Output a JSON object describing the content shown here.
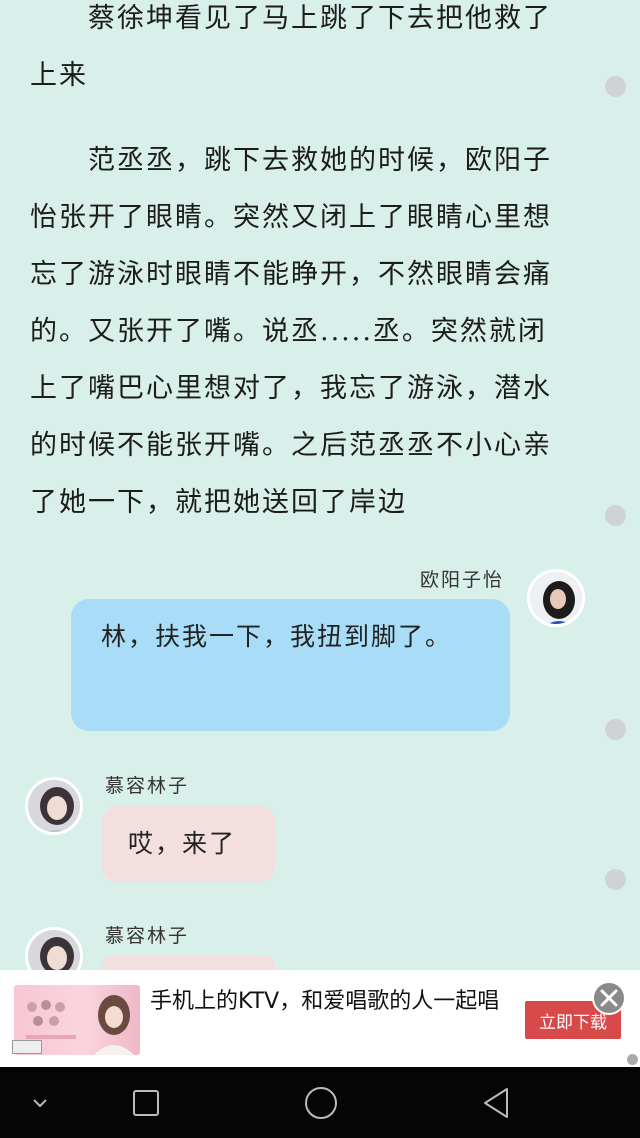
{
  "story": {
    "paragraph1": "蔡徐坤看见了马上跳了下去把他救了上来",
    "paragraph2": "范丞丞，跳下去救她的时候，欧阳子怡张开了眼睛。突然又闭上了眼睛心里想忘了游泳时眼睛不能睁开，不然眼睛会痛的。又张开了嘴。说丞.....丞。突然就闭上了嘴巴心里想对了，我忘了游泳，潜水的时候不能张开嘴。之后范丞丞不小心亲了她一下，就把她送回了岸边"
  },
  "chat": {
    "msg1": {
      "sender": "欧阳子怡",
      "text": "林，扶我一下，我扭到脚了。"
    },
    "msg2": {
      "sender": "慕容林子",
      "text": "哎，来了"
    },
    "msg3": {
      "sender": "慕容林子",
      "text": ""
    }
  },
  "ad": {
    "text": "手机上的KTV，和爱唱歌的人一起唱",
    "cta": "立即下载"
  },
  "colors": {
    "background": "#d9efea",
    "bubble_blue": "#a9dcf6",
    "bubble_pink": "#f4dfdf",
    "ad_cta": "#d84a4a"
  },
  "icons": [
    "close-icon",
    "back-icon",
    "home-icon",
    "recents-icon",
    "collapse-icon"
  ]
}
